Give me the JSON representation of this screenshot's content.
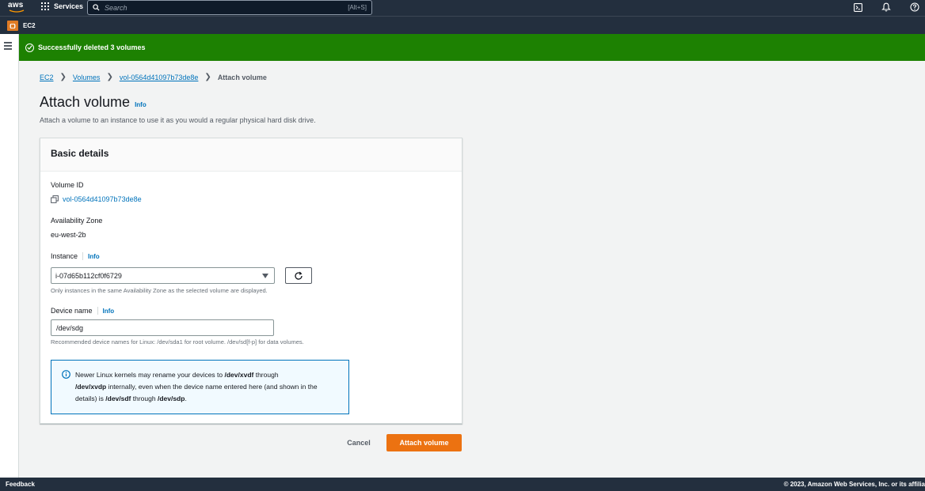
{
  "topnav": {
    "logo_text": "aws",
    "services_label": "Services",
    "search_placeholder": "Search",
    "search_shortcut": "[Alt+S]",
    "icons": [
      "cloudshell-icon",
      "bell-icon",
      "help-icon"
    ]
  },
  "subnav": {
    "service_label": "EC2"
  },
  "flash": {
    "message": "Successfully deleted 3 volumes",
    "color": "#1d8102"
  },
  "breadcrumb": {
    "items": [
      "EC2",
      "Volumes",
      "vol-0564d41097b73de8e"
    ],
    "current": "Attach volume"
  },
  "page": {
    "title": "Attach volume",
    "info": "Info",
    "description": "Attach a volume to an instance to use it as you would a regular physical hard disk drive."
  },
  "panel": {
    "header": "Basic details",
    "volume_id_label": "Volume ID",
    "volume_id": "vol-0564d41097b73de8e",
    "az_label": "Availability Zone",
    "az_value": "eu-west-2b",
    "instance_label": "Instance",
    "instance_info": "Info",
    "instance_value": "i-07d65b112cf0f6729",
    "instance_hint": "Only instances in the same Availability Zone as the selected volume are displayed.",
    "device_label": "Device name",
    "device_info": "Info",
    "device_value": "/dev/sdg",
    "device_hint": "Recommended device names for Linux: /dev/sda1 for root volume. /dev/sd[f-p] for data volumes.",
    "alert": {
      "t1": "Newer Linux kernels may rename your devices to ",
      "b1": "/dev/xvdf",
      "t2": " through ",
      "b2": "/dev/xvdp",
      "t3": " internally, even when the device name entered here (and shown in the details) is ",
      "b3": "/dev/sdf",
      "t4": " through ",
      "b4": "/dev/sdp",
      "t5": "."
    }
  },
  "actions": {
    "cancel": "Cancel",
    "attach": "Attach volume",
    "accent": "#ec7211"
  },
  "footer": {
    "feedback": "Feedback",
    "copyright": "© 2023, Amazon Web Services, Inc. or its affilia"
  }
}
